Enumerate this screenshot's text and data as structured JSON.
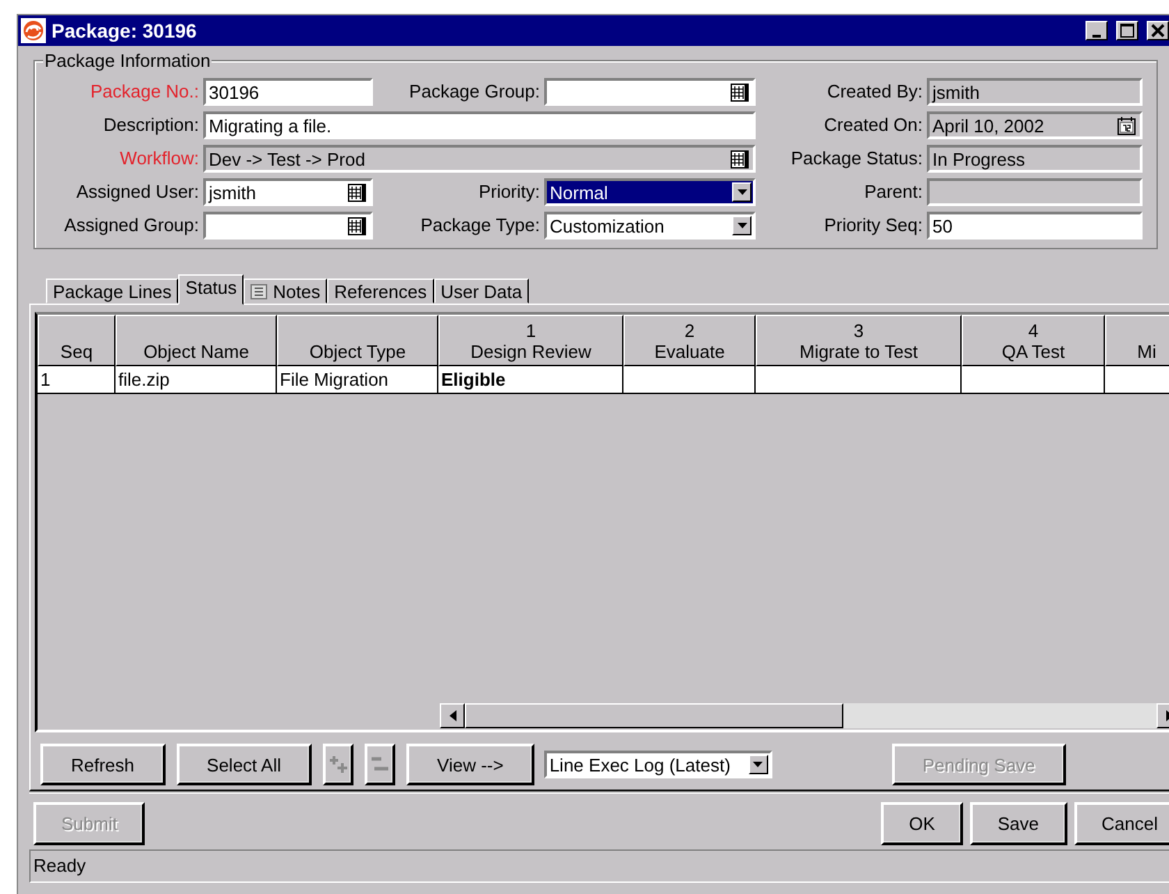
{
  "window": {
    "title": "Package: 30196"
  },
  "package_information": {
    "title": "Package Information",
    "rows": [
      {
        "fields": [
          {
            "label": "Package No.:",
            "kind": "text",
            "value": "30196",
            "required": true,
            "readonly": false
          },
          {
            "label": "Package Group:",
            "kind": "lookup",
            "required": false,
            "readonly": false
          },
          {
            "label": "Created By:",
            "kind": "text",
            "value": "jsmith",
            "required": false,
            "readonly": true
          }
        ]
      },
      {
        "fields": [
          {
            "label": "Description:",
            "kind": "text",
            "value": "Migrating a file.",
            "required": false,
            "readonly": false
          },
          {
            "label": "Created On:",
            "kind": "date",
            "value": "April 10, 2002",
            "required": false,
            "readonly": true
          }
        ]
      },
      {
        "fields": [
          {
            "label": "Workflow:",
            "kind": "lookup",
            "value": "Dev -> Test -> Prod",
            "required": true,
            "readonly": true
          },
          {
            "label": "Package Status:",
            "kind": "text",
            "value": "In Progress",
            "required": false,
            "readonly": true
          }
        ]
      },
      {
        "fields": [
          {
            "label": "Assigned User:",
            "kind": "lookup",
            "value": "jsmith",
            "required": false,
            "readonly": false
          },
          {
            "label": "Priority:",
            "kind": "select",
            "value": "Normal",
            "required": false,
            "readonly": false,
            "focused": true
          },
          {
            "label": "Parent:",
            "kind": "text",
            "required": false,
            "readonly": true
          }
        ]
      },
      {
        "fields": [
          {
            "label": "Assigned Group:",
            "kind": "lookup",
            "required": false,
            "readonly": false
          },
          {
            "label": "Package Type:",
            "kind": "select",
            "value": "Customization",
            "required": false,
            "readonly": false,
            "focused": false
          },
          {
            "label": "Priority Seq:",
            "kind": "text",
            "value": "50",
            "required": false,
            "readonly": false
          }
        ]
      }
    ]
  },
  "tabs": [
    {
      "label": "Package Lines",
      "kind": "plain",
      "selected": false
    },
    {
      "label": "Status",
      "kind": "plain",
      "selected": true
    },
    {
      "label": "Notes",
      "kind": "icon",
      "selected": false
    },
    {
      "label": "References",
      "kind": "plain",
      "selected": false
    },
    {
      "label": "User Data",
      "kind": "plain",
      "selected": false
    }
  ],
  "table": {
    "columns": [
      {
        "label": "Seq"
      },
      {
        "label": "Object Name"
      },
      {
        "label": "Object Type"
      },
      {
        "step": "1",
        "label": "Design Review"
      },
      {
        "step": "2",
        "label": "Evaluate"
      },
      {
        "step": "3",
        "label": "Migrate to Test"
      },
      {
        "step": "4",
        "label": "QA Test"
      },
      {
        "label": "Mi"
      }
    ],
    "rows": [
      {
        "seq": "1",
        "object_name": "file.zip",
        "object_type": "File Migration",
        "steps": [
          "Eligible"
        ]
      }
    ]
  },
  "toolbar": [
    {
      "kind": "button",
      "label": "Refresh",
      "disabled": false
    },
    {
      "kind": "button",
      "label": "Select All",
      "disabled": false
    },
    {
      "kind": "add",
      "disabled": true
    },
    {
      "kind": "remove",
      "disabled": true
    },
    {
      "kind": "button",
      "label": "View -->",
      "disabled": false
    },
    {
      "kind": "dropdown",
      "value": "Line Exec Log (Latest)"
    },
    {
      "kind": "spacer"
    },
    {
      "kind": "button",
      "label": "Pending Save",
      "disabled": true
    }
  ],
  "footer_buttons": [
    {
      "label": "Submit",
      "disabled": true
    },
    {
      "label": "OK",
      "disabled": false
    },
    {
      "label": "Save",
      "disabled": false
    },
    {
      "label": "Cancel",
      "disabled": false
    }
  ],
  "status_bar": {
    "text": "Ready"
  }
}
